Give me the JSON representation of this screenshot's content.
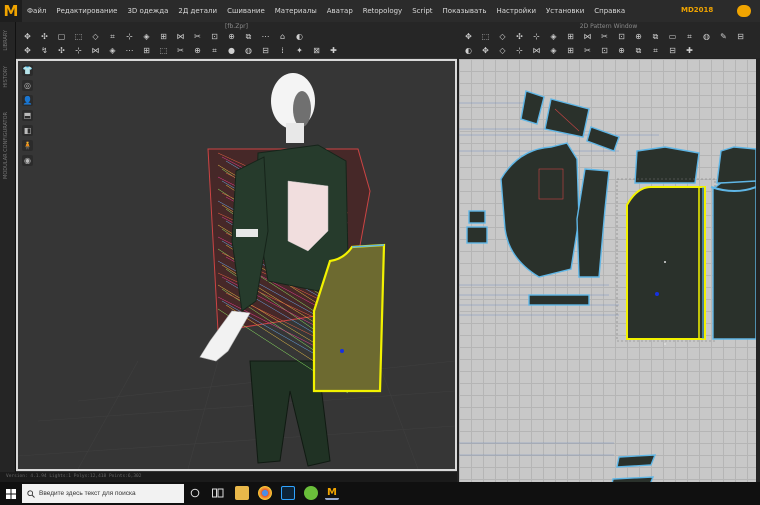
{
  "app": {
    "logo_letter": "M",
    "version_prefix": "",
    "version": "MD2018"
  },
  "menu": [
    "Файл",
    "Редактирование",
    "3D одежда",
    "2Д детали",
    "Сшивание",
    "Материалы",
    "Аватар",
    "Retopology",
    "Script",
    "Показывать",
    "Настройки",
    "Установки",
    "Справка"
  ],
  "left_tabs": [
    "LIBRARY",
    "HISTORY",
    "MODULAR CONFIGURATOR"
  ],
  "pane3d": {
    "title": "[fb.Zpr]",
    "toolbar_row1": [
      "✥",
      "✣",
      "▢",
      "⬚",
      "◇",
      "⌗",
      "⊹",
      "◈",
      "⊞",
      "⋈",
      "✂",
      "⊡",
      "⊕",
      "⧉",
      "⋯",
      "⌂",
      "◐"
    ],
    "toolbar_row2": [
      "✥",
      "↯",
      "✣",
      "⊹",
      "⋈",
      "◈",
      "⋯",
      "⊞",
      "⬚",
      "✂",
      "⊕",
      "⌗",
      "●",
      "◍",
      "⊟",
      "⁞",
      "✦",
      "⊠",
      "✚"
    ],
    "viewport_tools": [
      "👕",
      "◎",
      "👤",
      "⬒",
      "◧",
      "🧍",
      "◉"
    ]
  },
  "pane2d": {
    "title": "2D Pattern Window",
    "toolbar_row1": [
      "✥",
      "⬚",
      "◇",
      "✣",
      "⊹",
      "◈",
      "⊞",
      "⋈",
      "✂",
      "⊡",
      "⊕",
      "⧉",
      "▭",
      "⌗",
      "◍",
      "✎",
      "⊟"
    ],
    "toolbar_row2": [
      "◐",
      "✥",
      "◇",
      "⊹",
      "⋈",
      "◈",
      "⊞",
      "✂",
      "⊡",
      "⊕",
      "⧉",
      "⌗",
      "⊟",
      "✚"
    ]
  },
  "status_text": "Version: 4.1.94  Lights:1  Polys:12,418  Points:6,302",
  "taskbar": {
    "search_placeholder": "Введите здесь текст для поиска"
  },
  "colors": {
    "accent": "#f0a400",
    "selected_pattern": "#f2f200",
    "pattern_outline": "#5fb6e6",
    "pattern_fill": "#2a312b"
  }
}
